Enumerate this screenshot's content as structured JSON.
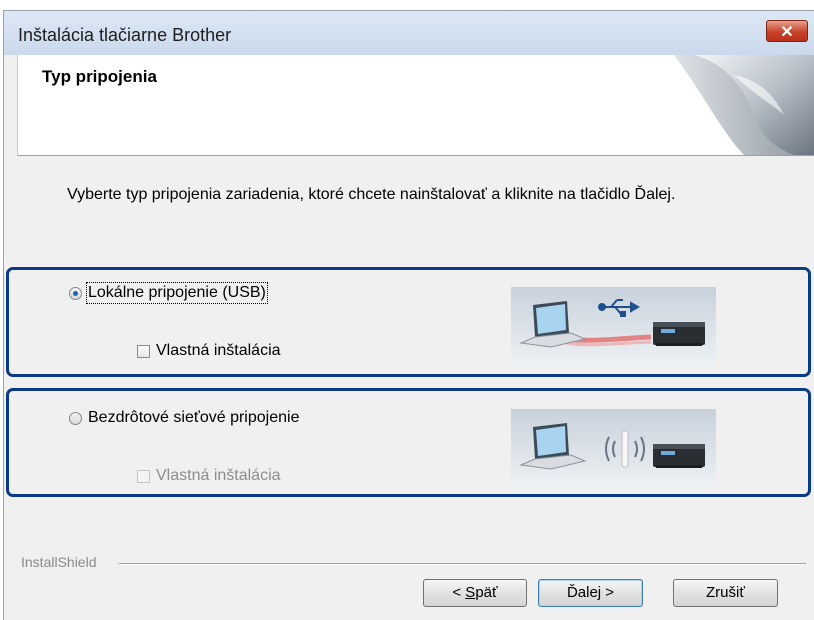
{
  "window": {
    "title": "Inštalácia tlačiarne Brother",
    "close_icon_glyph": "✕"
  },
  "header": {
    "title": "Typ pripojenia"
  },
  "instruction": "Vyberte typ pripojenia zariadenia, ktoré chcete nainštalovať a kliknite na tlačidlo Ďalej.",
  "options": [
    {
      "label": "Lokálne pripojenie (USB)",
      "selected": true,
      "custom_install_label": "Vlastná inštalácia",
      "custom_install_checked": false,
      "custom_install_enabled": true,
      "illustration": "laptop-usb-printer"
    },
    {
      "label": "Bezdrôtové sieťové pripojenie",
      "selected": false,
      "custom_install_label": "Vlastná inštalácia",
      "custom_install_checked": false,
      "custom_install_enabled": false,
      "illustration": "laptop-wireless-printer"
    }
  ],
  "footer": {
    "brand": "InstallShield",
    "back_prefix": "< ",
    "back_mnemonic": "S",
    "back_rest": "päť",
    "next_label": "Ďalej >",
    "cancel_label": "Zrušiť"
  },
  "colors": {
    "highlight_border": "#0b3b86",
    "close_button": "#c7422a"
  }
}
